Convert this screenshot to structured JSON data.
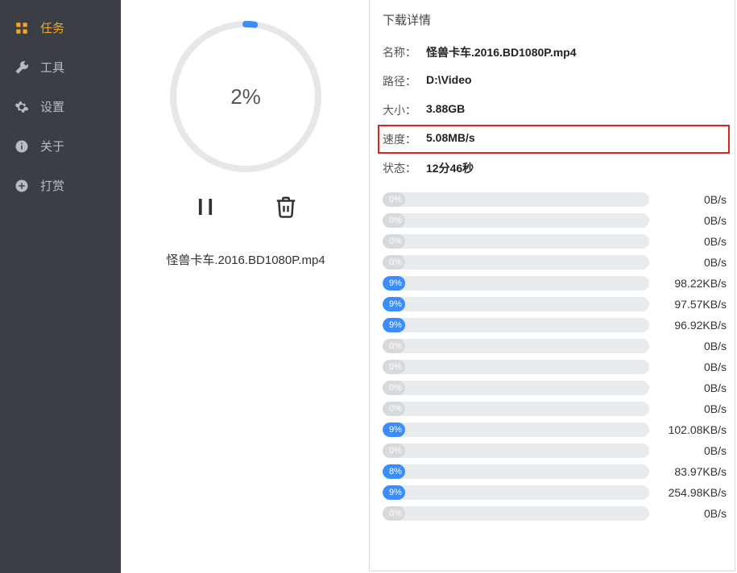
{
  "sidebar": {
    "items": [
      {
        "key": "tasks",
        "label": "任务",
        "icon": "grid-icon",
        "active": true
      },
      {
        "key": "tools",
        "label": "工具",
        "icon": "wrench-icon",
        "active": false
      },
      {
        "key": "settings",
        "label": "设置",
        "icon": "gear-icon",
        "active": false
      },
      {
        "key": "about",
        "label": "关于",
        "icon": "info-icon",
        "active": false
      },
      {
        "key": "donate",
        "label": "打赏",
        "icon": "plus-circle-icon",
        "active": false
      }
    ]
  },
  "task": {
    "progress_percent": 2,
    "progress_label": "2%",
    "filename": "怪兽卡车.2016.BD1080P.mp4"
  },
  "details": {
    "title": "下载详情",
    "labels": {
      "name": "名称：",
      "path": "路径：",
      "size": "大小：",
      "speed": "速度：",
      "status": "状态："
    },
    "values": {
      "name": "怪兽卡车.2016.BD1080P.mp4",
      "path": "D:\\Video",
      "size": "3.88GB",
      "speed": "5.08MB/s",
      "status": "12分46秒"
    },
    "highlight_field": "speed"
  },
  "connections": [
    {
      "pct": 0,
      "pct_label": "0%",
      "speed": "0B/s"
    },
    {
      "pct": 0,
      "pct_label": "0%",
      "speed": "0B/s"
    },
    {
      "pct": 0,
      "pct_label": "0%",
      "speed": "0B/s"
    },
    {
      "pct": 0,
      "pct_label": "0%",
      "speed": "0B/s"
    },
    {
      "pct": 9,
      "pct_label": "9%",
      "speed": "98.22KB/s"
    },
    {
      "pct": 9,
      "pct_label": "9%",
      "speed": "97.57KB/s"
    },
    {
      "pct": 9,
      "pct_label": "9%",
      "speed": "96.92KB/s"
    },
    {
      "pct": 0,
      "pct_label": "0%",
      "speed": "0B/s"
    },
    {
      "pct": 0,
      "pct_label": "0%",
      "speed": "0B/s"
    },
    {
      "pct": 0,
      "pct_label": "0%",
      "speed": "0B/s"
    },
    {
      "pct": 0,
      "pct_label": "0%",
      "speed": "0B/s"
    },
    {
      "pct": 9,
      "pct_label": "9%",
      "speed": "102.08KB/s"
    },
    {
      "pct": 0,
      "pct_label": "0%",
      "speed": "0B/s"
    },
    {
      "pct": 8,
      "pct_label": "8%",
      "speed": "83.97KB/s"
    },
    {
      "pct": 9,
      "pct_label": "9%",
      "speed": "254.98KB/s"
    },
    {
      "pct": 0,
      "pct_label": "0%",
      "speed": "0B/s"
    }
  ],
  "colors": {
    "accent": "#f5a623",
    "bar_fill": "#3a8dff",
    "highlight_border": "#d22"
  }
}
